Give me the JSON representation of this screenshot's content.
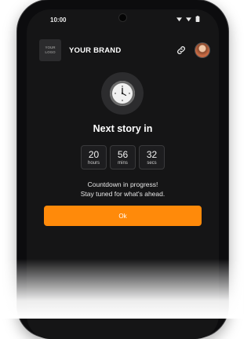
{
  "status_bar": {
    "time": "10:00",
    "icons": [
      "signal-icon",
      "wifi-icon",
      "battery-icon"
    ]
  },
  "header": {
    "logo_text_line1": "YOUR",
    "logo_text_line2": "LOGO",
    "brand_name": "YOUR BRAND",
    "link_icon": "link-icon",
    "avatar": "avatar"
  },
  "countdown_screen": {
    "icon": "clock-icon",
    "title": "Next story in",
    "units": [
      {
        "value": "20",
        "label": "hours"
      },
      {
        "value": "56",
        "label": "mins"
      },
      {
        "value": "32",
        "label": "secs"
      }
    ],
    "message_line1": "Countdown in progress!",
    "message_line2": "Stay tuned for what's ahead.",
    "button_label": "Ok"
  },
  "colors": {
    "accent": "#ff8a0a",
    "background": "#151516",
    "unit_box": "#1d1d1f"
  }
}
